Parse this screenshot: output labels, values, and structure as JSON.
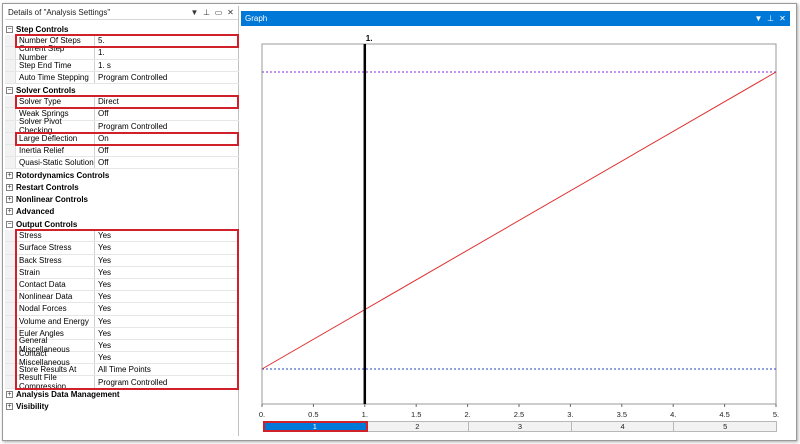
{
  "details": {
    "title": "Details of \"Analysis Settings\"",
    "icons": [
      "chevron-down-icon",
      "pin-icon",
      "float-window-icon",
      "close-icon"
    ],
    "icon_glyphs": [
      "▼",
      "⊥",
      "▭",
      "✕"
    ],
    "groups": [
      {
        "label": "Step Controls",
        "expanded": true,
        "props": [
          {
            "name": "Number Of Steps",
            "value": "5."
          },
          {
            "name": "Current Step Number",
            "value": "1."
          },
          {
            "name": "Step End Time",
            "value": "1. s"
          },
          {
            "name": "Auto Time Stepping",
            "value": "Program Controlled"
          }
        ]
      },
      {
        "label": "Solver Controls",
        "expanded": true,
        "props": [
          {
            "name": "Solver Type",
            "value": "Direct"
          },
          {
            "name": "Weak Springs",
            "value": "Off"
          },
          {
            "name": "Solver Pivot Checking",
            "value": "Program Controlled"
          },
          {
            "name": "Large Deflection",
            "value": "On"
          },
          {
            "name": "Inertia Relief",
            "value": "Off"
          },
          {
            "name": "Quasi-Static Solution",
            "value": "Off"
          }
        ]
      },
      {
        "label": "Rotordynamics Controls",
        "expanded": false,
        "props": []
      },
      {
        "label": "Restart Controls",
        "expanded": false,
        "props": []
      },
      {
        "label": "Nonlinear Controls",
        "expanded": false,
        "props": []
      },
      {
        "label": "Advanced",
        "expanded": false,
        "props": []
      },
      {
        "label": "Output Controls",
        "expanded": true,
        "props": [
          {
            "name": "Stress",
            "value": "Yes"
          },
          {
            "name": "Surface Stress",
            "value": "Yes"
          },
          {
            "name": "Back Stress",
            "value": "Yes"
          },
          {
            "name": "Strain",
            "value": "Yes"
          },
          {
            "name": "Contact Data",
            "value": "Yes"
          },
          {
            "name": "Nonlinear Data",
            "value": "Yes"
          },
          {
            "name": "Nodal Forces",
            "value": "Yes"
          },
          {
            "name": "Volume and Energy",
            "value": "Yes"
          },
          {
            "name": "Euler Angles",
            "value": "Yes"
          },
          {
            "name": "General Miscellaneous",
            "value": "Yes"
          },
          {
            "name": "Contact Miscellaneous",
            "value": "Yes"
          },
          {
            "name": "Store Results At",
            "value": "All Time Points"
          },
          {
            "name": "Result File Compression",
            "value": "Program Controlled"
          }
        ]
      },
      {
        "label": "Analysis Data Management",
        "expanded": false,
        "props": []
      },
      {
        "label": "Visibility",
        "expanded": false,
        "props": []
      }
    ],
    "expand_glyph": "+",
    "collapse_glyph": "−"
  },
  "graph": {
    "title": "Graph",
    "icons": [
      "chevron-down-icon",
      "pin-icon",
      "close-icon"
    ],
    "icon_glyphs": [
      "▼",
      "⊥",
      "✕"
    ],
    "current_step_label": "1.",
    "x_ticks": [
      "0.",
      "0.5",
      "1.",
      "1.5",
      "2.",
      "2.5",
      "3.",
      "3.5",
      "4.",
      "4.5",
      "5."
    ],
    "x_range": [
      0,
      5
    ],
    "current_time": 1,
    "line_color": "#e03030",
    "limit_color": "#8a2be2",
    "step_tabs": [
      "1",
      "2",
      "3",
      "4",
      "5"
    ],
    "active_step": 0,
    "accent": "#0078d7",
    "highlight": "#d0202a"
  }
}
